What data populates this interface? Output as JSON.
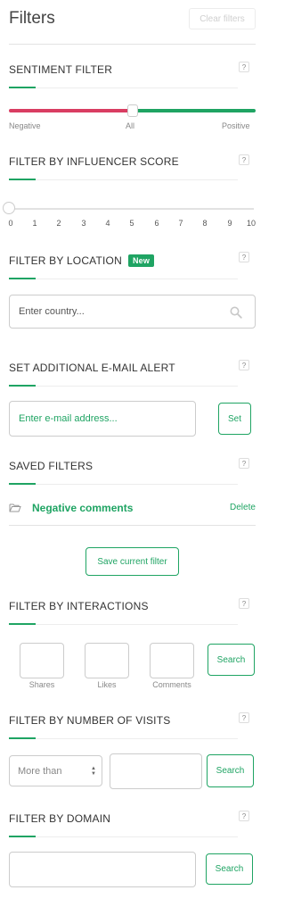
{
  "header": {
    "title": "Filters",
    "clear_label": "Clear filters"
  },
  "help_glyph": "?",
  "sentiment": {
    "title": "SENTIMENT FILTER",
    "left_label": "Negative",
    "mid_label": "All",
    "right_label": "Positive",
    "colors": {
      "negative": "#d93d62",
      "positive": "#1fa463"
    }
  },
  "influencer": {
    "title": "FILTER BY INFLUENCER SCORE",
    "ticks": [
      "0",
      "1",
      "2",
      "3",
      "4",
      "5",
      "6",
      "7",
      "8",
      "9",
      "10"
    ],
    "value": 0
  },
  "location": {
    "title": "FILTER BY LOCATION",
    "badge": "New",
    "placeholder": "Enter country..."
  },
  "email_alert": {
    "title": "SET ADDITIONAL E-MAIL ALERT",
    "placeholder": "Enter e-mail address...",
    "button": "Set"
  },
  "saved_filters": {
    "title": "SAVED FILTERS",
    "items": [
      {
        "name": "Negative comments",
        "delete": "Delete"
      }
    ],
    "save_button": "Save current filter"
  },
  "interactions": {
    "title": "FILTER BY INTERACTIONS",
    "labels": [
      "Shares",
      "Likes",
      "Comments"
    ],
    "button": "Search"
  },
  "visits": {
    "title": "FILTER BY NUMBER OF VISITS",
    "select_value": "More than",
    "button": "Search"
  },
  "domain": {
    "title": "FILTER BY DOMAIN",
    "button": "Search"
  },
  "accent_color": "#1fa463"
}
